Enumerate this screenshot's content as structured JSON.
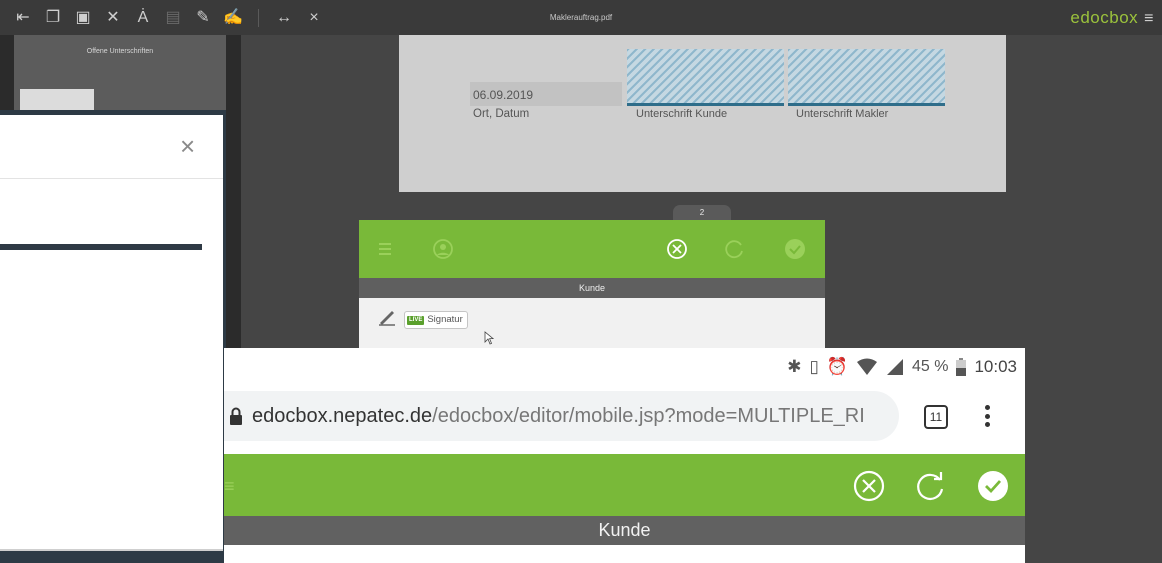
{
  "app": {
    "document_title": "Maklerauftrag.pdf",
    "brand": "edocbox",
    "brand_menu_icon": "hamburger-icon"
  },
  "toolbar": {
    "icons": [
      "insert-page-icon",
      "copy-icon",
      "screen-icon",
      "tools-icon",
      "text-cursor-icon",
      "save-icon",
      "pen-icon",
      "signature-icon",
      "fit-width-icon",
      "close-icon"
    ]
  },
  "sidebar": {
    "title": "Offene Unterschriften"
  },
  "document": {
    "date_value": "06.09.2019",
    "date_label": "Ort, Datum",
    "signature_customer": "Unterschrift Kunde",
    "signature_broker": "Unterschrift Makler",
    "page_number": "2"
  },
  "mini_panel": {
    "role_label": "Kunde",
    "live_tag": "LIVE",
    "signature_label": "Signatur"
  },
  "dialog": {
    "close_glyph": "×"
  },
  "phone": {
    "battery_percent": "45 %",
    "time": "10:03",
    "url_host": "edocbox.nepatec.de",
    "url_path": "/edocbox/editor/mobile.jsp?mode=MULTIPLE_RI",
    "tab_count": "11",
    "role_label": "Kunde"
  },
  "colors": {
    "accent_green": "#79b939",
    "brand_green": "#9bc23c",
    "signature_blue": "#2e6d8a"
  }
}
